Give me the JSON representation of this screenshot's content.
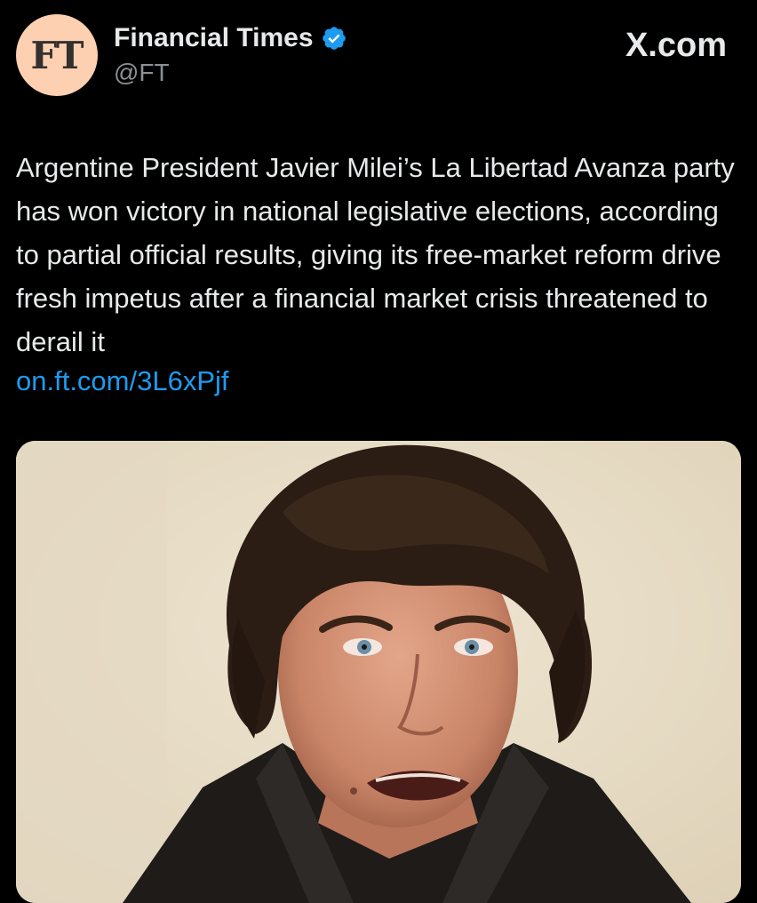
{
  "header": {
    "avatar_text": "FT",
    "display_name": "Financial Times",
    "handle": "@FT",
    "verified_icon": "verified-badge-icon",
    "brand": "X.com"
  },
  "tweet": {
    "text": "Argentine President Javier Milei’s La Libertad Avanza party has won victory in national legislative elections, according to partial official results, giving its free-market reform drive fresh impetus after a financial market crisis threatened to derail it",
    "link": "on.ft.com/3L6xPjf"
  },
  "colors": {
    "background": "#000000",
    "text": "#e7e9ea",
    "secondary_text": "#8b9095",
    "link": "#1d9bf0",
    "ft_avatar": "#fcd0b1",
    "verified": "#1d9bf0"
  }
}
